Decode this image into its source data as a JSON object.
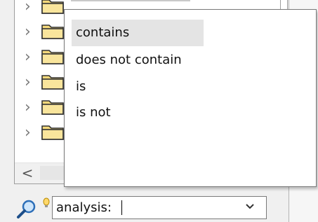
{
  "filter_operators": {
    "items": [
      {
        "label": "contains",
        "highlighted": true
      },
      {
        "label": "does not contain",
        "highlighted": false
      },
      {
        "label": "is",
        "highlighted": false
      },
      {
        "label": "is not",
        "highlighted": false
      }
    ]
  },
  "search": {
    "value": "analysis:",
    "icon": "magnifier-icon",
    "hint_icon": "lightbulb-icon",
    "dropdown_icon": "chevron-down-icon"
  },
  "tree": {
    "row_count": 5,
    "chevron_glyph": "›",
    "folder_color": "#f5d97b"
  },
  "scrollbar": {
    "left_arrow_glyph": "<"
  },
  "colors": {
    "highlight": "#e4e4e4",
    "border": "#7a7a7a"
  }
}
